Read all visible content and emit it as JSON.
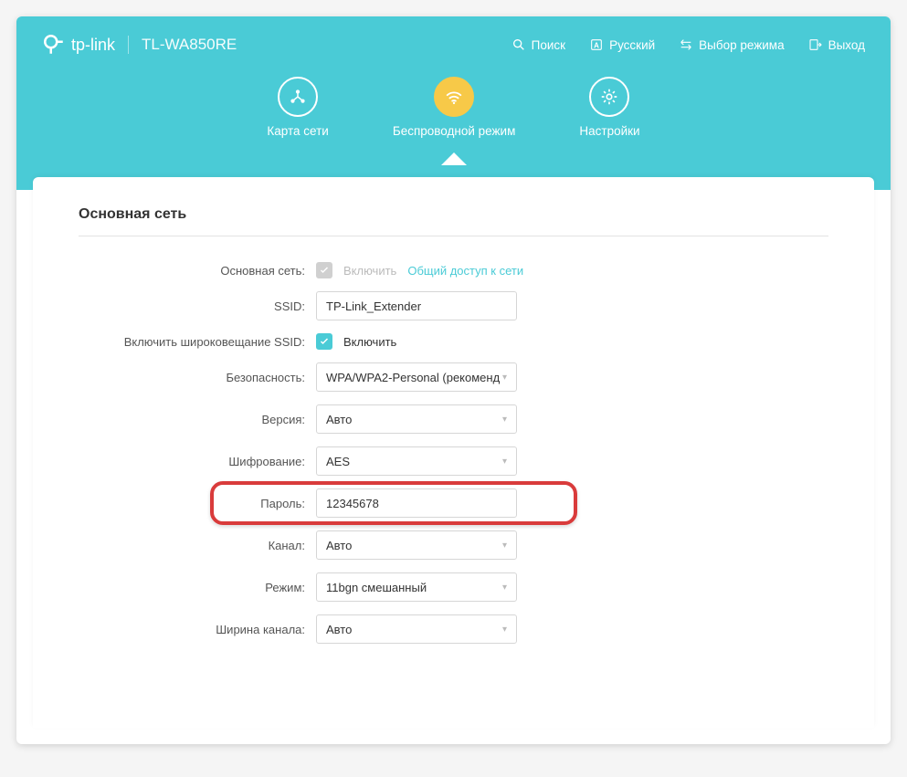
{
  "brand": {
    "name": "tp-link",
    "model": "TL-WA850RE"
  },
  "top_actions": {
    "search": "Поиск",
    "language": "Русский",
    "mode": "Выбор режима",
    "logout": "Выход"
  },
  "nav": {
    "map": "Карта сети",
    "wireless": "Беспроводной режим",
    "settings": "Настройки"
  },
  "section": {
    "title": "Основная сеть"
  },
  "form": {
    "host_label": "Основная сеть:",
    "enable": "Включить",
    "share_link": "Общий доступ к сети",
    "ssid_label": "SSID:",
    "ssid_value": "TP-Link_Extender",
    "broadcast_label": "Включить широковещание SSID:",
    "security_label": "Безопасность:",
    "security_value": "WPA/WPA2-Personal (рекоменд",
    "version_label": "Версия:",
    "version_value": "Авто",
    "encryption_label": "Шифрование:",
    "encryption_value": "AES",
    "password_label": "Пароль:",
    "password_value": "12345678",
    "channel_label": "Канал:",
    "channel_value": "Авто",
    "mode_label": "Режим:",
    "mode_value": "11bgn смешанный",
    "width_label": "Ширина канала:",
    "width_value": "Авто"
  }
}
